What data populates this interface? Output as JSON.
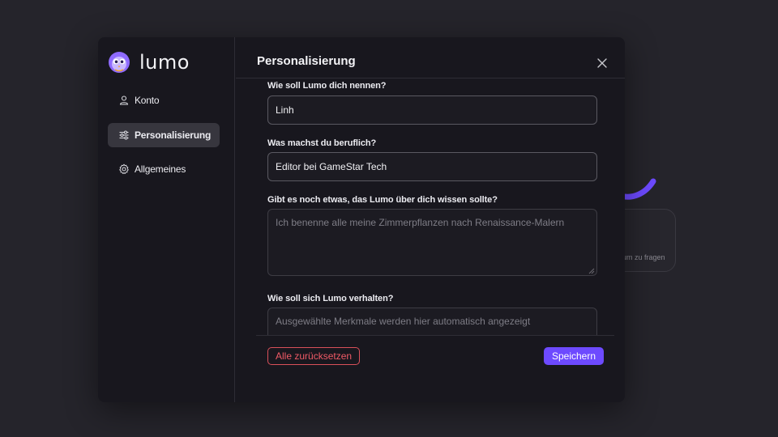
{
  "background": {
    "card_text": "um zu fragen"
  },
  "brand": {
    "name": "lumo",
    "logo_icon": "cat-mascot-icon"
  },
  "sidebar": {
    "items": [
      {
        "label": "Konto",
        "icon": "user-icon",
        "active": false
      },
      {
        "label": "Personalisierung",
        "icon": "sliders-icon",
        "active": true
      },
      {
        "label": "Allgemeines",
        "icon": "gear-icon",
        "active": false
      }
    ]
  },
  "panel": {
    "title": "Personalisierung",
    "close_icon": "close-icon",
    "fields": {
      "name": {
        "label": "Wie soll Lumo dich nennen?",
        "value": "Linh"
      },
      "job": {
        "label": "Was machst du beruflich?",
        "value": "Editor bei GameStar Tech"
      },
      "about": {
        "label": "Gibt es noch etwas, das Lumo über dich wissen sollte?",
        "placeholder": "Ich benenne alle meine Zimmerpflanzen nach Renaissance-Malern",
        "value": ""
      },
      "behavior": {
        "label": "Wie soll sich Lumo verhalten?",
        "placeholder": "Ausgewählte Merkmale werden hier automatisch angezeigt",
        "value": ""
      }
    },
    "buttons": {
      "reset_label": "Alle zurücksetzen",
      "save_label": "Speichern"
    }
  },
  "colors": {
    "accent": "#6d4aff",
    "danger": "#f05a66",
    "modal_bg": "#18171e",
    "page_bg": "#25242b"
  }
}
